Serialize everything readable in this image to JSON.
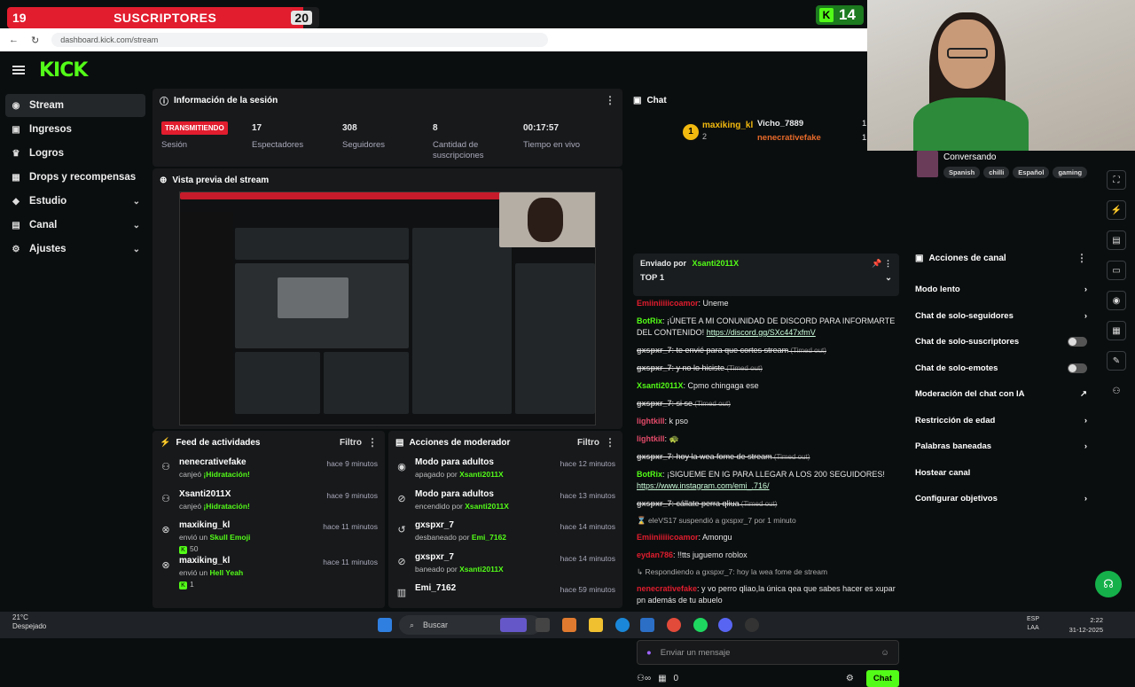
{
  "overlay": {
    "sub_current": "19",
    "sub_label": "SUSCRIPTORES",
    "sub_goal": "20",
    "sub_progress": 0.95,
    "kick_badge_count": "14"
  },
  "browser": {
    "url": "dashboard.kick.com/stream"
  },
  "brand": {
    "logo": "KICK",
    "accent": "#53fc18",
    "live_color": "#e11d2e"
  },
  "sidebar": {
    "items": [
      {
        "label": "Stream",
        "icon": "broadcast-icon",
        "active": true,
        "expandable": false
      },
      {
        "label": "Ingresos",
        "icon": "wallet-icon",
        "active": false,
        "expandable": false
      },
      {
        "label": "Logros",
        "icon": "trophy-icon",
        "active": false,
        "expandable": false
      },
      {
        "label": "Drops y recompensas",
        "icon": "gift-icon",
        "active": false,
        "expandable": false
      },
      {
        "label": "Estudio",
        "icon": "studio-icon",
        "active": false,
        "expandable": true
      },
      {
        "label": "Canal",
        "icon": "channel-icon",
        "active": false,
        "expandable": true
      },
      {
        "label": "Ajustes",
        "icon": "gear-icon",
        "active": false,
        "expandable": true
      }
    ]
  },
  "session": {
    "title": "Información de la sesión",
    "status": "TRANSMITIENDO",
    "status_label": "Sesión",
    "viewers": "17",
    "viewers_label": "Espectadores",
    "followers": "308",
    "followers_label": "Seguidores",
    "subs": "8",
    "subs_label": "Cantidad de suscripciones",
    "uptime": "00:17:57",
    "uptime_label": "Tiempo en vivo"
  },
  "preview": {
    "title": "Vista previa del stream"
  },
  "feed": {
    "title": "Feed de actividades",
    "filter": "Filtro",
    "items": [
      {
        "user": "nenecrativefake",
        "action": "canjeó ",
        "reward": "¡Hidratación!",
        "time": "hace 9 minutos",
        "amount": ""
      },
      {
        "user": "Xsanti2011X",
        "action": "canjeó ",
        "reward": "¡Hidratación!",
        "time": "hace 9 minutos",
        "amount": ""
      },
      {
        "user": "maxiking_kl",
        "action": "envió un ",
        "reward": "Skull Emoji",
        "time": "hace 11 minutos",
        "amount": "50"
      },
      {
        "user": "maxiking_kl",
        "action": "envió un ",
        "reward": "Hell Yeah",
        "time": "hace 11 minutos",
        "amount": "1"
      }
    ]
  },
  "mod_actions": {
    "title": "Acciones de moderador",
    "filter": "Filtro",
    "items": [
      {
        "title": "Modo para adultos",
        "action": "apagado por ",
        "by": "Xsanti2011X",
        "time": "hace 12 minutos"
      },
      {
        "title": "Modo para adultos",
        "action": "encendido por ",
        "by": "Xsanti2011X",
        "time": "hace 13 minutos"
      },
      {
        "title": "gxspxr_7",
        "action": "desbaneado por ",
        "by": "Emi_7162",
        "time": "hace 14 minutos"
      },
      {
        "title": "gxspxr_7",
        "action": "baneado por ",
        "by": "Xsanti2011X",
        "time": "hace 14 minutos"
      },
      {
        "title": "Emi_7162",
        "action": "",
        "by": "",
        "time": "hace 59 minutos"
      }
    ]
  },
  "chat": {
    "title": "Chat",
    "leaderboard": [
      {
        "rank": "1",
        "name": "maxiking_kl",
        "count": "2"
      },
      {
        "name": "Vicho_7889",
        "count": "1"
      },
      {
        "name": "nenecrativefake",
        "count": "1"
      }
    ],
    "pinned": {
      "label": "Enviado por",
      "user": "Xsanti2011X",
      "text": "TOP 1"
    },
    "messages": [
      {
        "user": "Emiiniiiiicoamor",
        "color": "#e11d2e",
        "text": ": Uneme",
        "del": false
      },
      {
        "user": "BotRix",
        "color": "#53fc18",
        "text": ": ¡ÚNETE A MI CONUNIDAD DE DISCORD PARA INFORMARTE DEL CONTENIDO! ",
        "link": "https://discord.gg/SXc447xfmV",
        "del": false
      },
      {
        "user": "gxspxr_7",
        "color": "#bbb",
        "text": ": te envié para que cortes stream",
        "tag": "(Timed out)",
        "del": true
      },
      {
        "user": "gxspxr_7",
        "color": "#bbb",
        "text": ": y no lo hiciste",
        "tag": "(Timed out)",
        "del": true
      },
      {
        "user": "Xsanti2011X",
        "color": "#53fc18",
        "text": ": Cpmo chingaga ese",
        "del": false
      },
      {
        "user": "gxspxr_7",
        "color": "#bbb",
        "text": ": si se",
        "tag": "(Timed out)",
        "del": true
      },
      {
        "user": "lightkill",
        "color": "#e34b6a",
        "text": ": k pso",
        "del": false
      },
      {
        "user": "lightkill",
        "color": "#e34b6a",
        "text": ": 🐢",
        "del": false
      },
      {
        "user": "gxspxr_7",
        "color": "#bbb",
        "text": ": hoy la wea fome de stream",
        "tag": "(Timed out)",
        "del": true
      },
      {
        "user": "BotRix",
        "color": "#53fc18",
        "text": ": ¡SIGUEME EN IG PARA LLEGAR A LOS 200 SEGUIDORES! ",
        "link": "https://www.instagram.com/emi_.716/",
        "del": false
      },
      {
        "user": "gxspxr_7",
        "color": "#bbb",
        "text": ": cállate perra qliua",
        "tag": "(Timed out)",
        "del": true
      }
    ],
    "system": "eleVS17 suspendió a gxspxr_7 por 1 minuto",
    "messages2": [
      {
        "user": "Emiiniiiiicoamor",
        "color": "#e11d2e",
        "text": ": Amongu"
      },
      {
        "user": "eydan786",
        "color": "#e11d2e",
        "text": ": !!tts juguemo roblox"
      }
    ],
    "reply_to": "Respondiendo a gxspxr_7: hoy la wea fome de stream",
    "last": {
      "user": "nenecrativefake",
      "color": "#e11d2e",
      "text": ": y vo perro qliao,la única qea que sabes hacer es xupar pn además de tu abuelo"
    },
    "placeholder": "Enviar un mensaje",
    "points": "0",
    "send": "Chat"
  },
  "stream_info": {
    "category": "Conversando",
    "tags": [
      "Spanish",
      "chilli",
      "Español",
      "gaming"
    ]
  },
  "channel_actions": {
    "title": "Acciones de canal",
    "items": [
      {
        "label": "Modo lento",
        "kind": "chevron"
      },
      {
        "label": "Chat de solo-seguidores",
        "kind": "chevron"
      },
      {
        "label": "Chat de solo-suscriptores",
        "kind": "toggle"
      },
      {
        "label": "Chat de solo-emotes",
        "kind": "toggle"
      },
      {
        "label": "Moderación del chat con IA",
        "kind": "external"
      },
      {
        "label": "Restricción de edad",
        "kind": "chevron"
      },
      {
        "label": "Palabras baneadas",
        "kind": "chevron"
      },
      {
        "label": "Hostear canal",
        "kind": "none"
      },
      {
        "label": "Configurar objetivos",
        "kind": "chevron"
      }
    ]
  },
  "taskbar": {
    "temp": "21°C",
    "weather": "Despejado",
    "search": "Buscar",
    "lang1": "ESP",
    "lang2": "LAA",
    "time": "2:22",
    "date": "31-12-2025"
  }
}
